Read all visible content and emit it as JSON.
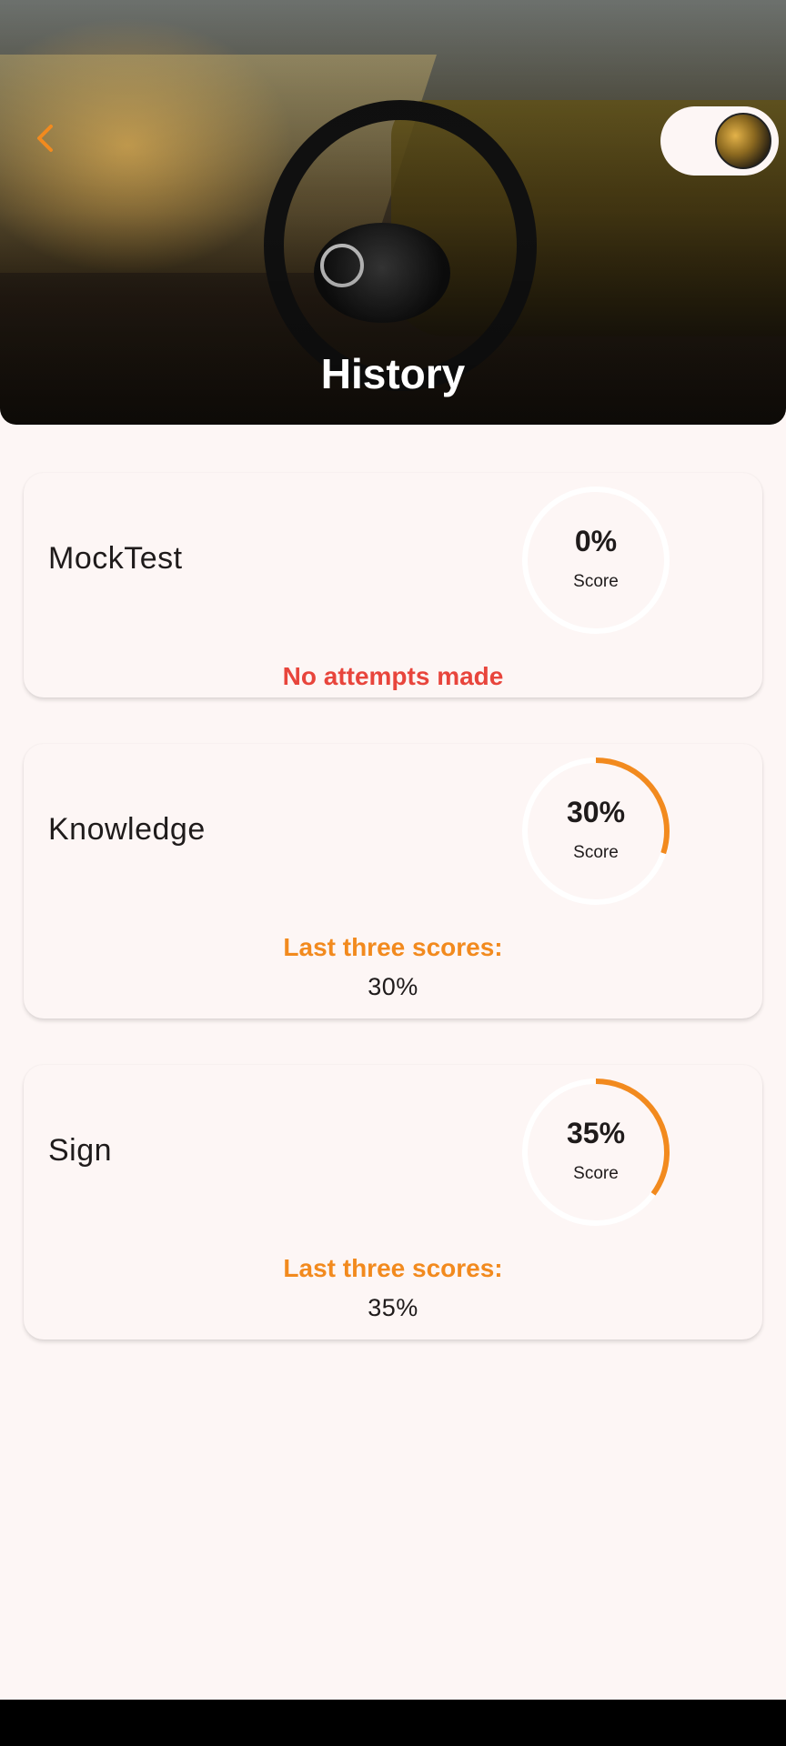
{
  "header": {
    "title": "History",
    "back_icon": "chevron-left-icon",
    "toggle_icon": "theme-toggle-icon"
  },
  "colors": {
    "accent": "#f28a1e",
    "error": "#e8453c",
    "track": "#ffffff",
    "background": "#fdf6f5"
  },
  "cards": [
    {
      "title": "MockTest",
      "score_text": "0%",
      "score_fraction": 0.0,
      "score_label": "Score",
      "message": "No attempts made"
    },
    {
      "title": "Knowledge",
      "score_text": "30%",
      "score_fraction": 0.3,
      "score_label": "Score",
      "scores_heading": "Last three scores:",
      "scores_values": "30%"
    },
    {
      "title": "Sign",
      "score_text": "35%",
      "score_fraction": 0.35,
      "score_label": "Score",
      "scores_heading": "Last three scores:",
      "scores_values": "35%"
    }
  ]
}
